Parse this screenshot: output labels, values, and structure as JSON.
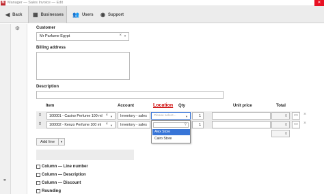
{
  "window": {
    "title": "Manager — Sales Invoice — Edit",
    "close_glyph": "✕",
    "app_icon_letter": "M"
  },
  "toolbar": {
    "tabs": [
      {
        "label": "Back",
        "icon": "back-arrow-icon"
      },
      {
        "label": "Businesses",
        "icon": "businesses-icon"
      },
      {
        "label": "Users",
        "icon": "users-icon"
      },
      {
        "label": "Support",
        "icon": "support-icon"
      }
    ]
  },
  "form": {
    "customer_label": "Customer",
    "customer_value": "Mr Parfume Egypt",
    "billing_label": "Billing address",
    "billing_value": "",
    "description_label": "Description",
    "description_value": ""
  },
  "lines": {
    "headers": {
      "item": "Item",
      "account": "Account",
      "location": "Location",
      "qty": "Qty",
      "unit_price": "Unit price",
      "total": "Total"
    },
    "rows": [
      {
        "item": "100001 - Casino Perfume 100 ml",
        "account": "Inventory - sales",
        "location": "Please select...",
        "qty": "1",
        "unit_price": "",
        "total": "0"
      },
      {
        "item": "100002 - Kenzo Perfume 100 ml",
        "account": "Inventory - sales",
        "location": "",
        "qty": "1",
        "unit_price": "",
        "total": "0"
      }
    ],
    "grand_total": "0"
  },
  "location_dropdown": {
    "options": [
      "Alex Store",
      "Cairo Store"
    ],
    "highlighted": "Alex Store"
  },
  "buttons": {
    "add_line": "Add line"
  },
  "options": [
    {
      "label": "Column — Line number",
      "checked": false
    },
    {
      "label": "Column — Description",
      "checked": false
    },
    {
      "label": "Column — Discount",
      "checked": false
    },
    {
      "label": "Rounding",
      "checked": false
    }
  ],
  "colors": {
    "accent": "#3875d7",
    "location_header": "#cc0000"
  }
}
